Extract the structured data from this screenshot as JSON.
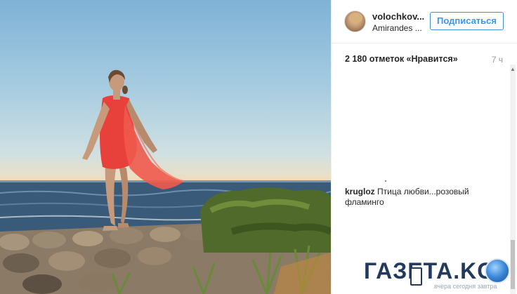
{
  "post": {
    "username": "volochkov...",
    "location": "Amirandes ...",
    "follow_label": "Подписаться",
    "likes": "2 180 отметок «Нравится»",
    "time": "7 ч",
    "comment": {
      "user": "krugloz",
      "text": "Птица любви...розовый фламинго"
    }
  },
  "watermark": {
    "brand": "ГАЗЕТА.KG",
    "tagline": "вчера сегодня завтра"
  },
  "colors": {
    "follow_blue": "#3897f0",
    "dress_red": "#e8403a",
    "brand_navy": "#223a5e"
  }
}
